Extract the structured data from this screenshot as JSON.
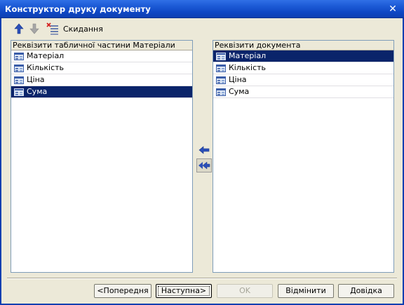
{
  "window": {
    "title": "Конструктор друку документу",
    "close_glyph": "✕"
  },
  "toolbar": {
    "reset_label": "Скидання"
  },
  "left_list": {
    "header": "Реквізити табличної частини Матеріали",
    "items": [
      {
        "label": "Матеріал",
        "selected": false
      },
      {
        "label": "Кількість",
        "selected": false
      },
      {
        "label": "Ціна",
        "selected": false
      },
      {
        "label": "Сума",
        "selected": true
      }
    ]
  },
  "right_list": {
    "header": "Реквізити документа",
    "items": [
      {
        "label": "Матеріал",
        "selected": true
      },
      {
        "label": "Кількість",
        "selected": false
      },
      {
        "label": "Ціна",
        "selected": false
      },
      {
        "label": "Сума",
        "selected": false
      }
    ]
  },
  "buttons": {
    "previous": "<Попередня",
    "next": "Наступна>",
    "ok": "OK",
    "cancel": "Відмінити",
    "help": "Довідка"
  },
  "colors": {
    "selection": "#0a246a",
    "titlebar": "#0f47c4",
    "arrow": "#2b4fb8"
  }
}
